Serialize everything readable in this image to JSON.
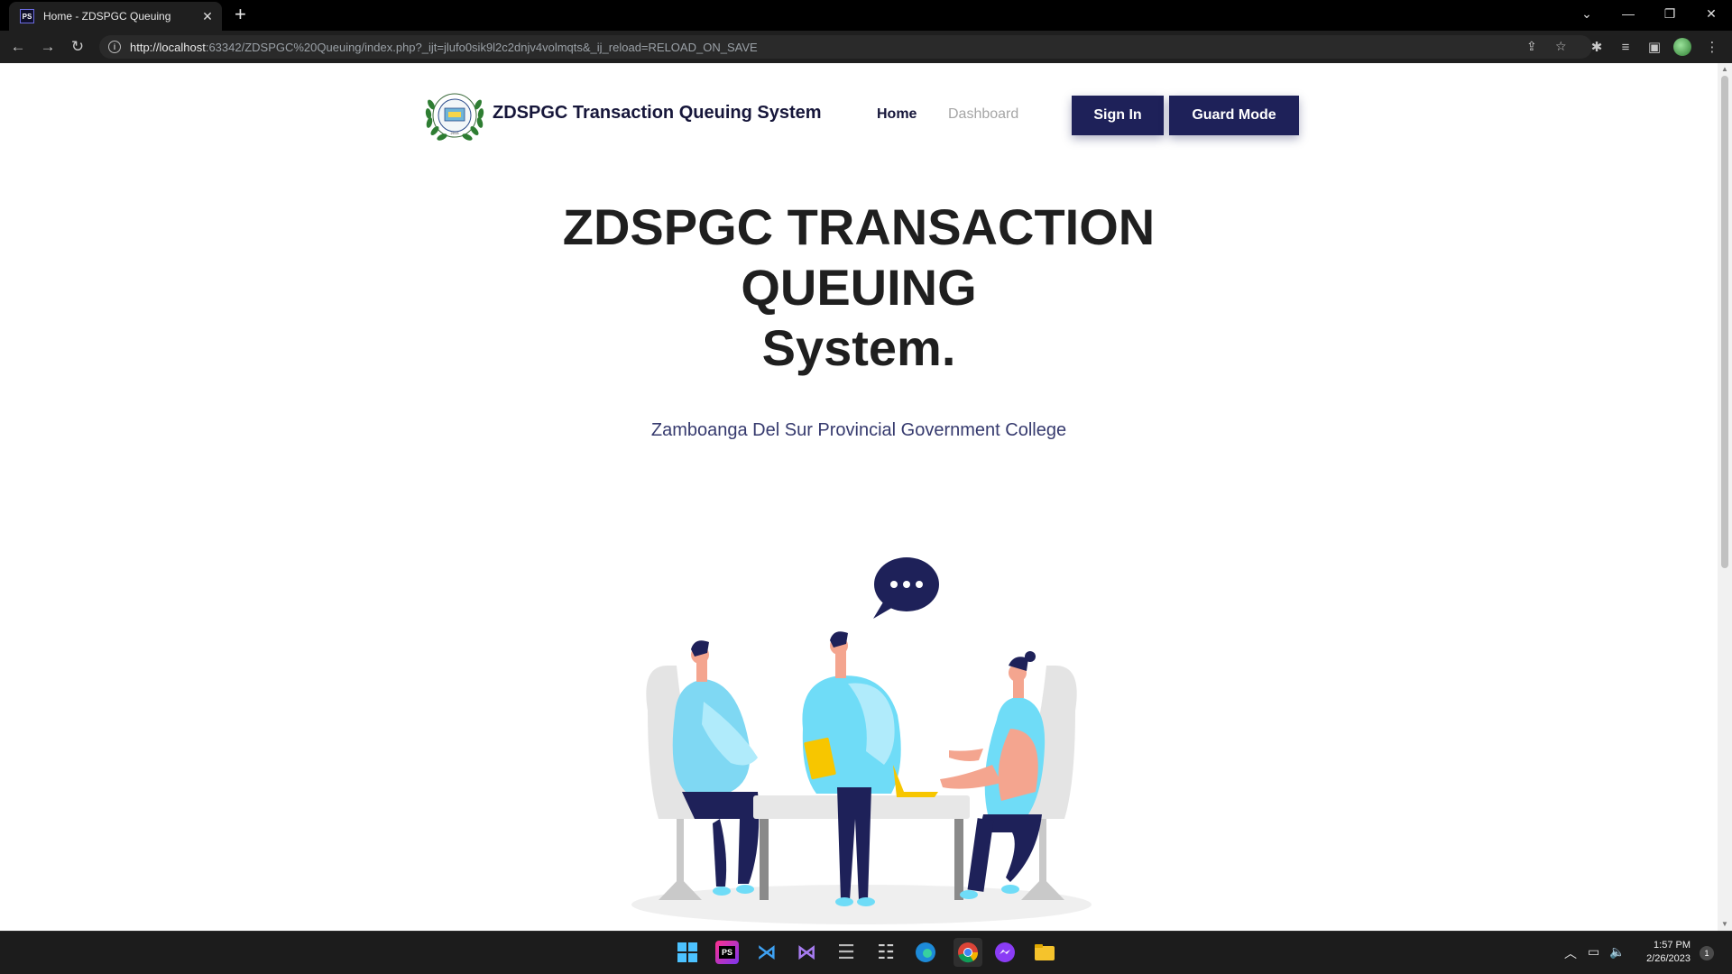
{
  "browser": {
    "tab_title": "Home - ZDSPGC Queuing",
    "tab_favicon": "PS",
    "url_host": "http://localhost",
    "url_rest": ":63342/ZDSPGC%20Queuing/index.php?_ijt=jlufo0sik9l2c2dnjv4volmqts&_ij_reload=RELOAD_ON_SAVE"
  },
  "nav": {
    "brand": "ZDSPGC Transaction Queuing System",
    "home": "Home",
    "dashboard": "Dashboard",
    "sign_in": "Sign In",
    "guard_mode": "Guard Mode"
  },
  "hero": {
    "title_line1": "ZDSPGC TRANSACTION",
    "title_line2": "QUEUING",
    "title_word": "System",
    "title_dot": ".",
    "subtitle": "Zamboanga Del Sur Provincial Government College"
  },
  "taskbar": {
    "apps": [
      "windows-start",
      "phpstorm",
      "vscode",
      "visual-studio",
      "database",
      "database-2",
      "edge",
      "chrome",
      "messenger",
      "file-explorer"
    ],
    "time": "1:57 PM",
    "date": "2/26/2023",
    "notification_count": "1"
  },
  "colors": {
    "brand_navy": "#1e2159",
    "accent_yellow": "#f7c600",
    "figure_blue": "#6fdcf7"
  }
}
